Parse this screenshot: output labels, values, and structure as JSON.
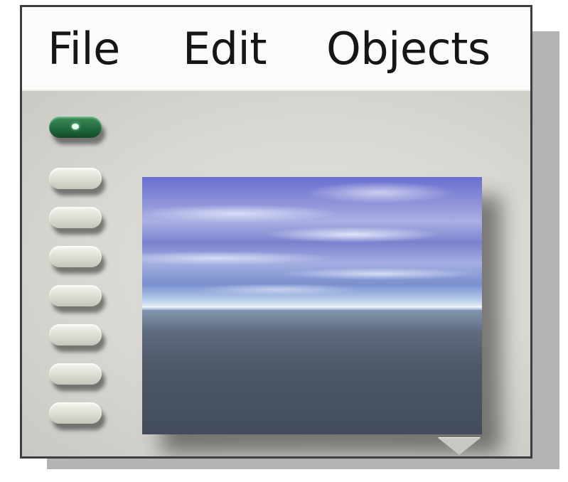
{
  "menubar": {
    "items": [
      {
        "label": "File"
      },
      {
        "label": "Edit"
      },
      {
        "label": "Objects"
      }
    ]
  },
  "buttons": {
    "count": 8,
    "active_index": 0
  },
  "preview": {
    "content": "sky-and-ground-environment"
  },
  "icons": {
    "scroll": "triangle-down-icon"
  },
  "colors": {
    "active_button": "#226a3d",
    "inactive_button": "#dedfd5",
    "panel": "#d6d5cf",
    "menubar": "#fbfbfa"
  }
}
